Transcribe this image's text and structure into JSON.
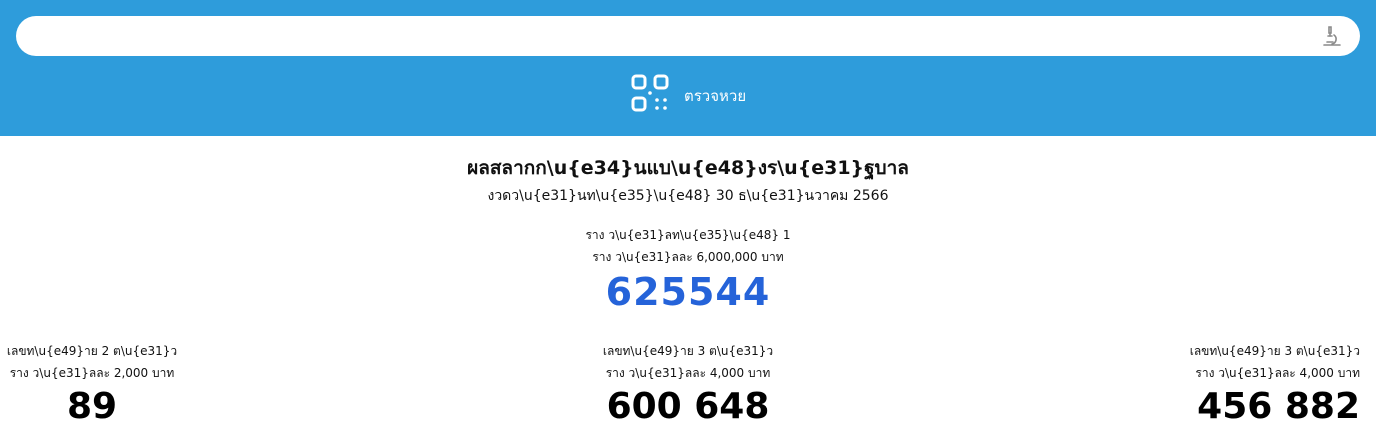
{
  "search": {
    "value": "",
    "placeholder": ""
  },
  "icons": {
    "voice": "microscope-icon",
    "scan": "qr-code-icon"
  },
  "check_button": {
    "label": "ตรวจหวย"
  },
  "colors": {
    "header_bg": "#2e9cdb",
    "first_prize": "#2563d9"
  },
  "results": {
    "title": "ผลสลากก\\u{e34}นแบ\\u{e48}งร\\u{e31}ฐบาล",
    "draw_date": "งวดว\\u{e31}นท\\u{e35}\\u{e48} 30 ธ\\u{e31}นวาคม 2566",
    "first_prize": {
      "label": "ราง ว\\u{e31}ลท\\u{e35}\\u{e48} 1",
      "amount": "ราง ว\\u{e31}ลละ 6,000,000 บาท",
      "number": "625544"
    },
    "two_digit": {
      "label": "เลขท\\u{e49}าย 2 ต\\u{e31}ว",
      "amount": "ราง ว\\u{e31}ลละ 2,000 บาท",
      "number": "89"
    },
    "front_three": {
      "label": "เลขท\\u{e49}าย 3 ต\\u{e31}ว",
      "amount": "ราง ว\\u{e31}ลละ 4,000 บาท",
      "number": "600 648"
    },
    "back_three": {
      "label": "เลขท\\u{e49}าย 3 ต\\u{e31}ว",
      "amount": "ราง ว\\u{e31}ลละ 4,000 บาท",
      "number": "456 882"
    }
  }
}
